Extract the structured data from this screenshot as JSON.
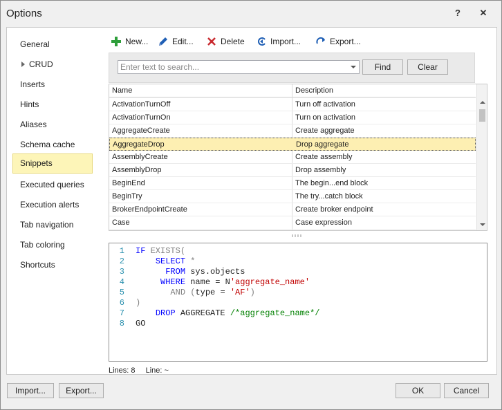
{
  "window": {
    "title": "Options",
    "help": "?",
    "close": "✕"
  },
  "sidebar": {
    "items": [
      {
        "label": "General"
      },
      {
        "label": "CRUD"
      },
      {
        "label": "Inserts"
      },
      {
        "label": "Hints"
      },
      {
        "label": "Aliases"
      },
      {
        "label": "Schema cache"
      },
      {
        "label": "Snippets"
      },
      {
        "label": "Executed queries"
      },
      {
        "label": "Execution alerts"
      },
      {
        "label": "Tab navigation"
      },
      {
        "label": "Tab coloring"
      },
      {
        "label": "Shortcuts"
      }
    ],
    "active": "Snippets"
  },
  "toolbar": {
    "new_label": "New...",
    "edit_label": "Edit...",
    "delete_label": "Delete",
    "import_label": "Import...",
    "export_label": "Export..."
  },
  "search": {
    "placeholder": "Enter text to search...",
    "value": "",
    "find_label": "Find",
    "clear_label": "Clear"
  },
  "grid": {
    "columns": [
      "Name",
      "Description"
    ],
    "rows": [
      {
        "name": "ActivationTurnOff",
        "desc": "Turn off activation"
      },
      {
        "name": "ActivationTurnOn",
        "desc": "Turn on activation"
      },
      {
        "name": "AggregateCreate",
        "desc": "Create aggregate"
      },
      {
        "name": "AggregateDrop",
        "desc": "Drop aggregate"
      },
      {
        "name": "AssemblyCreate",
        "desc": "Create assembly"
      },
      {
        "name": "AssemblyDrop",
        "desc": "Drop assembly"
      },
      {
        "name": "BeginEnd",
        "desc": "The begin...end block"
      },
      {
        "name": "BeginTry",
        "desc": "The try...catch block"
      },
      {
        "name": "BrokerEndpointCreate",
        "desc": "Create broker endpoint"
      },
      {
        "name": "Case",
        "desc": "Case expression"
      }
    ],
    "selected_row": "AggregateDrop"
  },
  "editor": {
    "line_numbers": [
      "1",
      "2",
      "3",
      "4",
      "5",
      "6",
      "7",
      "8"
    ],
    "tokens": {
      "l1_kw": "IF",
      "l1_gray": " EXISTS(",
      "l2_kw": "SELECT",
      "l2_gray": " *",
      "l3_kw": "FROM",
      "l3_txt": " sys.objects",
      "l4_kw": "WHERE",
      "l4_txt": " name = N",
      "l4_str": "'aggregate_name'",
      "l5_gray": "AND",
      "l5_txt1": " (",
      "l5_txt2": "type = ",
      "l5_str": "'AF'",
      "l5_txt3": ")",
      "l6_gray": ")",
      "l7_kw": "DROP",
      "l7_txt": " AGGREGATE ",
      "l7_cmt": "/*aggregate_name*/",
      "l8_txt": "GO"
    }
  },
  "status": {
    "lines": "Lines: 8",
    "line": "Line: ~"
  },
  "footer": {
    "import_label": "Import...",
    "export_label": "Export...",
    "ok_label": "OK",
    "cancel_label": "Cancel"
  },
  "colors": {
    "accent_selected": "#fdf5b8",
    "keyword": "#0000ff",
    "string": "#c00000",
    "comment": "#008000",
    "line_number": "#2b91af"
  }
}
